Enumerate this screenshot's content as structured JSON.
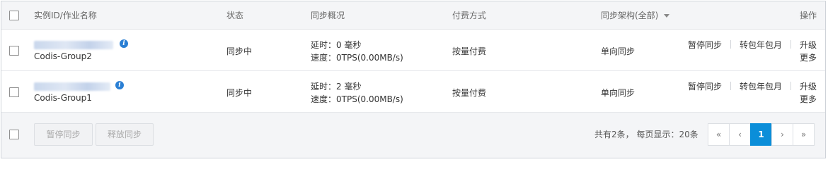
{
  "header": {
    "col_id": "实例ID/作业名称",
    "col_status": "状态",
    "col_sync": "同步概况",
    "col_billing": "付费方式",
    "col_arch": "同步架构(全部)",
    "col_ops": "操作"
  },
  "rows": [
    {
      "name": "Codis-Group2",
      "status": "同步中",
      "delay": "延时：0 毫秒",
      "speed": "速度：0TPS(0.00MB/s)",
      "billing": "按量付费",
      "arch": "单向同步",
      "op_pause": "暂停同步",
      "op_convert": "转包年包月",
      "op_upgrade": "升级",
      "op_more": "更多"
    },
    {
      "name": "Codis-Group1",
      "status": "同步中",
      "delay": "延时：2 毫秒",
      "speed": "速度：0TPS(0.00MB/s)",
      "billing": "按量付费",
      "arch": "单向同步",
      "op_pause": "暂停同步",
      "op_convert": "转包年包月",
      "op_upgrade": "升级",
      "op_more": "更多"
    }
  ],
  "footer": {
    "pause_btn": "暂停同步",
    "release_btn": "释放同步",
    "summary": "共有2条， 每页显示：20条"
  },
  "pagination": {
    "first": "«",
    "prev": "‹",
    "current": "1",
    "next": "›",
    "last": "»"
  },
  "colors": {
    "status_ok": "#1e9e3a",
    "link": "#0b70c9",
    "page_active": "#0b8ed9"
  }
}
